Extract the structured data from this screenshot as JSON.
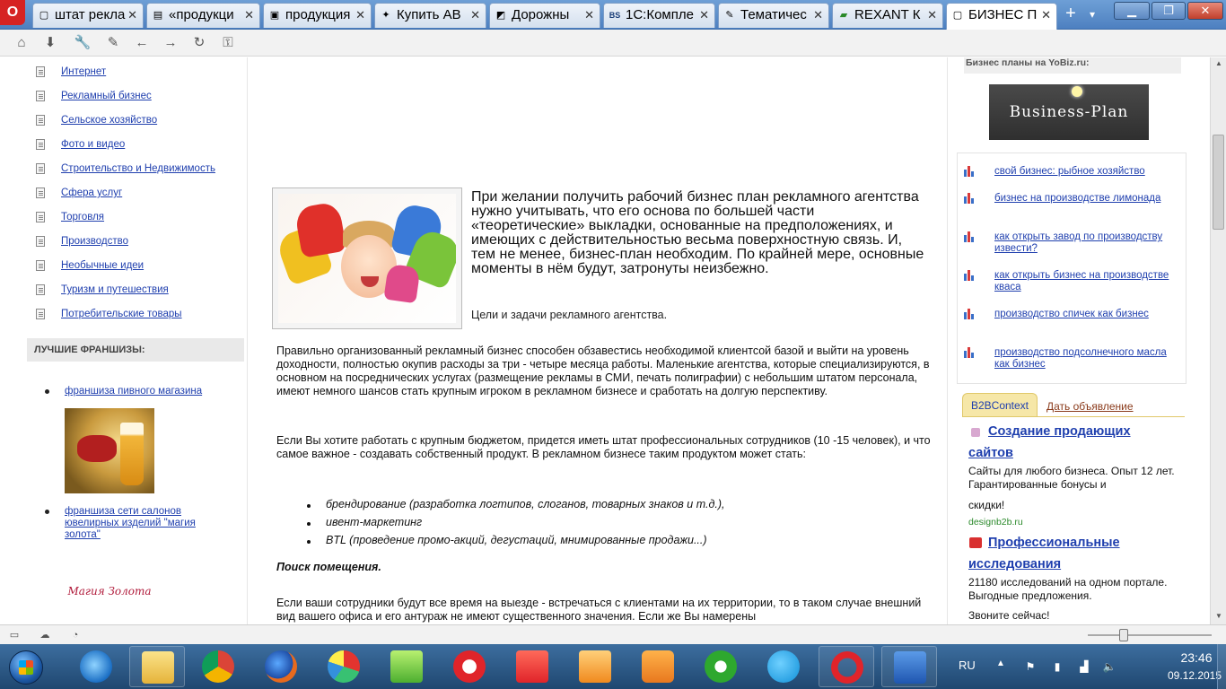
{
  "tabs": [
    {
      "label": "штат рекла",
      "icon": "page-icon",
      "active": false
    },
    {
      "label": "«продукци",
      "icon": "page-icon",
      "active": false
    },
    {
      "label": "продукция",
      "icon": "image-icon",
      "active": false
    },
    {
      "label": "Купить АВ",
      "icon": "page-icon",
      "active": false
    },
    {
      "label": "Дорожны",
      "icon": "page-icon",
      "active": false
    },
    {
      "label": "1С:Компле",
      "icon": "bs-icon",
      "active": false
    },
    {
      "label": "Тематичес",
      "icon": "page-icon",
      "active": false
    },
    {
      "label": "REXANT К",
      "icon": "page-icon",
      "active": false
    },
    {
      "label": "БИЗНЕС П",
      "icon": "page-icon",
      "active": true
    }
  ],
  "browser": {
    "logo": "O",
    "tab_icons": {
      "bs": "BS"
    }
  },
  "categories": [
    "Интернет",
    "Рекламный бизнес",
    "Сельское хозяйство",
    "Фото и видео",
    "Строительство и Недвижимость",
    "Сфера услуг",
    "Торговля",
    "Производство",
    "Необычные идеи",
    "Туризм и путешествия",
    "Потребительские товары"
  ],
  "franchises": {
    "heading": "ЛУЧШИЕ ФРАНШИЗЫ:",
    "items": [
      {
        "label": "франшиза пивного магазина"
      },
      {
        "label": "франшиза сети салонов ювелирных изделий \"магия золота\""
      }
    ],
    "gold_logo": "Магия Золота"
  },
  "article": {
    "intro": "При желании получить рабочий бизнес план рекламного агентства нужно учитывать, что его основа по большей части «теоретические» выкладки, основанные на предположениях, и имеющих с действительностью весьма поверхностную связь. И, тем не менее, бизнес-план необходим. По крайней мере, основные моменты в нём будут, затронуты неизбежно.",
    "subtitle": "Цели и задачи рекламного агентства.",
    "p1": "Правильно организованный рекламный бизнес способен обзавестись необходимой клиентсой базой и выйти на уровень доходности, полностью окупив расходы за три - четыре месяца работы. Маленькие агентства, которые специализируются, в основном на посреднических услугах (размещение рекламы в СМИ, печать полиграфии) с небольшим штатом персонала, имеют немного шансов стать крупным игроком в рекламном бизнесе и сработать на долгую перспективу.",
    "p2": "Если Вы хотите работать с крупным бюджетом, придется иметь штат профессиональных сотрудников (10 -15 человек), и что самое важное - создавать собственный продукт. В рекламном бизнесе таким продуктом может стать:",
    "bullets": [
      "брендирование (разработка логтипов, слоганов, товарных знаков и т.д.),",
      "ивент-маркетинг",
      "BTL (проведение промо-акций, дегустаций, мнимированные продажи...)"
    ],
    "search_heading": "Поиск помещения.",
    "p3": "Если ваши сотрудники будут все время на выезде - встречаться с клиентами на их территории, то в таком случае внешний вид вашего офиса и его антураж не имеют существенного значения. Если же Вы намерены"
  },
  "sidebar_right": {
    "heading": "Бизнес планы на YoBiz.ru:",
    "logo_text": "Business-Plan",
    "links": [
      "свой бизнес: рыбное хозяйство",
      "бизнес на производстве лимонада",
      "как открыть завод по производству извести?",
      "как открыть бизнес на производстве кваса",
      "производство спичек как бизнес",
      "производство подсолнечного масла как бизнес"
    ],
    "b2b_tab": "B2BContext",
    "b2b_ad_link": "Дать объявление",
    "ads": [
      {
        "title_line1": "Создание продающих",
        "title_line2": "сайтов",
        "text": "Сайты для любого бизнеса. Опыт 12 лет. Гарантированные бонусы и",
        "text2": "скидки!",
        "url": "designb2b.ru"
      },
      {
        "title_line1": "Профессиональные",
        "title_line2": "исследования",
        "text": "21180 исследований на одном портале. Выгодные предложения.",
        "text2": "Звоните сейчас!"
      }
    ]
  },
  "taskbar": {
    "lang": "RU",
    "time": "23:46",
    "date": "09.12.2015",
    "apps": [
      "explorer",
      "ie",
      "folder",
      "chrome",
      "firefox",
      "pie-app",
      "music",
      "search",
      "yandex",
      "video",
      "search2",
      "mail",
      "skype",
      "opera",
      "word"
    ]
  },
  "colors": {
    "link": "#1f3fae",
    "taskbar": "#2a5a8a",
    "tab_active": "#ffffff"
  }
}
